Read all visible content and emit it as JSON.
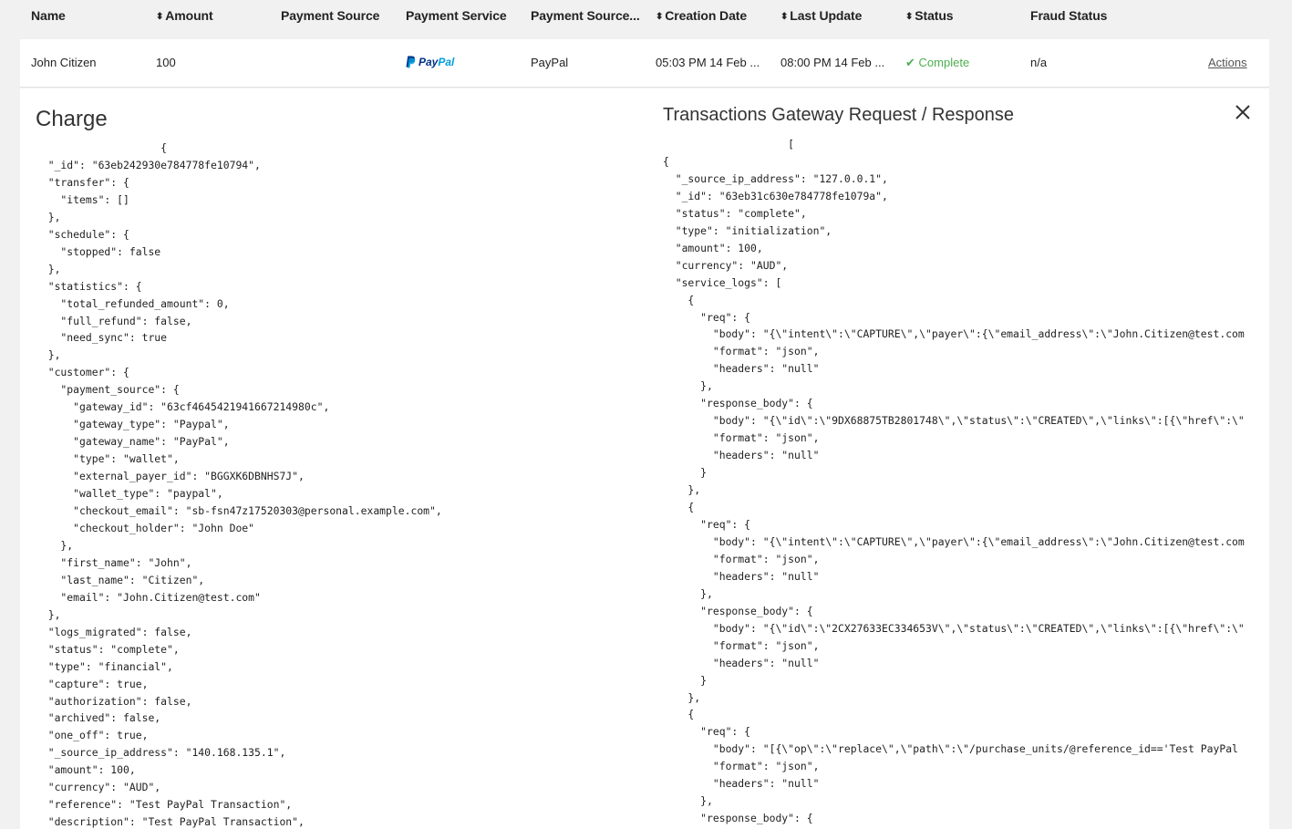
{
  "table": {
    "headers": {
      "name": "Name",
      "amount": "Amount",
      "payment_source": "Payment Source",
      "payment_service": "Payment Service",
      "payment_source_trunc": "Payment Source...",
      "creation_date": "Creation Date",
      "last_update": "Last Update",
      "status": "Status",
      "fraud_status": "Fraud Status"
    },
    "row": {
      "name": "John Citizen",
      "amount": "100",
      "payment_service_logo_a": "Pay",
      "payment_service_logo_b": "Pal",
      "payment_source": "PayPal",
      "creation_date": "05:03 PM 14 Feb ...",
      "last_update": "08:00 PM 14 Feb ...",
      "status_icon": "✔",
      "status": "Complete",
      "fraud_status": "n/a",
      "actions": "Actions"
    }
  },
  "panel": {
    "charge_title": "Charge",
    "tx_title": "Transactions Gateway Request / Response",
    "charge_json": "                    {\n  \"_id\": \"63eb242930e784778fe10794\",\n  \"transfer\": {\n    \"items\": []\n  },\n  \"schedule\": {\n    \"stopped\": false\n  },\n  \"statistics\": {\n    \"total_refunded_amount\": 0,\n    \"full_refund\": false,\n    \"need_sync\": true\n  },\n  \"customer\": {\n    \"payment_source\": {\n      \"gateway_id\": \"63cf4645421941667214980c\",\n      \"gateway_type\": \"Paypal\",\n      \"gateway_name\": \"PayPal\",\n      \"type\": \"wallet\",\n      \"external_payer_id\": \"BGGXK6DBNHS7J\",\n      \"wallet_type\": \"paypal\",\n      \"checkout_email\": \"sb-fsn47z17520303@personal.example.com\",\n      \"checkout_holder\": \"John Doe\"\n    },\n    \"first_name\": \"John\",\n    \"last_name\": \"Citizen\",\n    \"email\": \"John.Citizen@test.com\"\n  },\n  \"logs_migrated\": false,\n  \"status\": \"complete\",\n  \"type\": \"financial\",\n  \"capture\": true,\n  \"authorization\": false,\n  \"archived\": false,\n  \"one_off\": true,\n  \"_source_ip_address\": \"140.168.135.1\",\n  \"amount\": 100,\n  \"currency\": \"AUD\",\n  \"reference\": \"Test PayPal Transaction\",\n  \"description\": \"Test PayPal Transaction\",",
    "tx_json": "                    [\n{\n  \"_source_ip_address\": \"127.0.0.1\",\n  \"_id\": \"63eb31c630e784778fe1079a\",\n  \"status\": \"complete\",\n  \"type\": \"initialization\",\n  \"amount\": 100,\n  \"currency\": \"AUD\",\n  \"service_logs\": [\n    {\n      \"req\": {\n        \"body\": \"{\\\"intent\\\":\\\"CAPTURE\\\",\\\"payer\\\":{\\\"email_address\\\":\\\"John.Citizen@test.com\n        \"format\": \"json\",\n        \"headers\": \"null\"\n      },\n      \"response_body\": {\n        \"body\": \"{\\\"id\\\":\\\"9DX68875TB2801748\\\",\\\"status\\\":\\\"CREATED\\\",\\\"links\\\":[{\\\"href\\\":\\\"\n        \"format\": \"json\",\n        \"headers\": \"null\"\n      }\n    },\n    {\n      \"req\": {\n        \"body\": \"{\\\"intent\\\":\\\"CAPTURE\\\",\\\"payer\\\":{\\\"email_address\\\":\\\"John.Citizen@test.com\n        \"format\": \"json\",\n        \"headers\": \"null\"\n      },\n      \"response_body\": {\n        \"body\": \"{\\\"id\\\":\\\"2CX27633EC334653V\\\",\\\"status\\\":\\\"CREATED\\\",\\\"links\\\":[{\\\"href\\\":\\\"\n        \"format\": \"json\",\n        \"headers\": \"null\"\n      }\n    },\n    {\n      \"req\": {\n        \"body\": \"[{\\\"op\\\":\\\"replace\\\",\\\"path\\\":\\\"/purchase_units/@reference_id=='Test PayPal\n        \"format\": \"json\",\n        \"headers\": \"null\"\n      },\n      \"response_body\": {\n        \"body\": \"null\","
  },
  "icons": {
    "sort": "sort-icon",
    "check": "check-icon",
    "close": "close-icon",
    "paypal": "paypal-logo"
  },
  "colors": {
    "status_complete": "#4caf50",
    "paypal_dark": "#003087",
    "paypal_light": "#009cde"
  }
}
